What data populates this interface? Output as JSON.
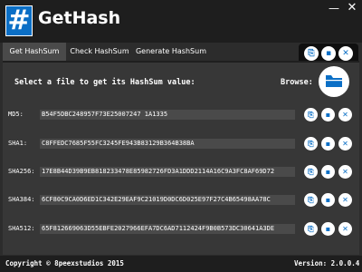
{
  "app": {
    "title": "GetHash",
    "logo_glyph": "#",
    "window_minimize": "—",
    "window_close": "✕"
  },
  "tabs": [
    {
      "label": "Get HashSum",
      "active": true
    },
    {
      "label": "Check HashSum",
      "active": false
    },
    {
      "label": "Generate HashSum",
      "active": false
    }
  ],
  "toolbar": {
    "icons": [
      "open-icon",
      "save-icon",
      "close-icon"
    ],
    "glyphs": [
      "⎘",
      "▪",
      "✕"
    ]
  },
  "main": {
    "select_label": "Select a file to get its HashSum value:",
    "browse_label": "Browse:",
    "browse_icon": "folder-icon"
  },
  "hashes": [
    {
      "label": "MD5:",
      "value": "B54F5DBC248957F73E25007247 1A1335"
    },
    {
      "label": "SHA1:",
      "value": "C8FFEDC7685F55FC3245FE943B83129B364B38BA"
    },
    {
      "label": "SHA256:",
      "value": "17E8B44D39B9EB818233478E85982726FD3A1DDD2114A16C9A3FC8AF69D72"
    },
    {
      "label": "SHA384:",
      "value": "6CF80C9CA0D6ED1C342E29EAF9C21019D0DC6D025E97F27C4B65498AA78C"
    },
    {
      "label": "SHA512:",
      "value": "65F812669063D55EBFE2027966EFA7DC6AD7112424F9B0B573DC30641A3DE"
    }
  ],
  "row_glyphs": {
    "copy": "⎘",
    "save": "▪",
    "clear": "✕"
  },
  "status": {
    "copyright": "Copyright © 8peexstudios 2015",
    "version": "Version: 2.0.0.4"
  },
  "colors": {
    "accent": "#0b6fc6",
    "background": "#2c2c2c",
    "panel": "#373737",
    "field": "#4a4a4a"
  }
}
